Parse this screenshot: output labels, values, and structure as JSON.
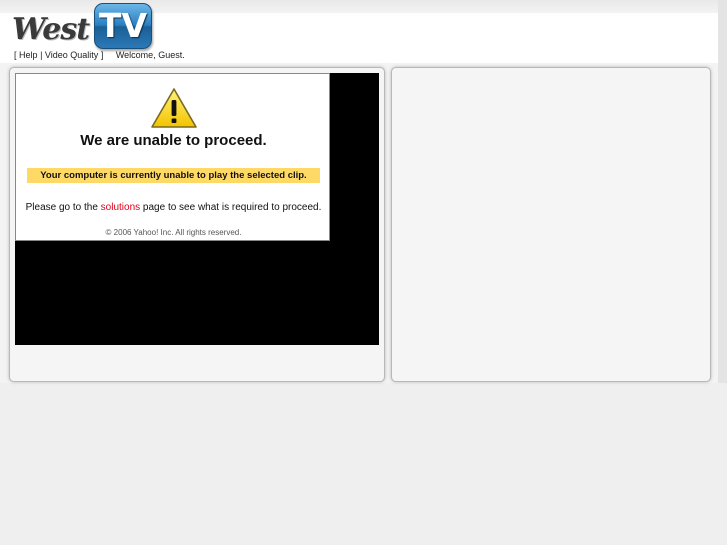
{
  "logo": {
    "word": "West",
    "badge": "TV"
  },
  "nav": {
    "open_bracket": "[",
    "help": "Help",
    "separator": "|",
    "video_quality": "Video Quality",
    "close_bracket": "]",
    "welcome": "Welcome, Guest."
  },
  "error": {
    "icon": "warning-triangle-icon",
    "title": "We are unable to proceed.",
    "highlight": "Your computer is currently unable to play the selected clip.",
    "msg_before": "Please go to the ",
    "link": "solutions",
    "msg_after": " page to see what is required to proceed.",
    "copyright": "© 2006 Yahoo! Inc. All rights reserved."
  },
  "colors": {
    "link": "#e0001b",
    "highlight": "#ffd966",
    "logo_badge": "#2a7fc0"
  }
}
